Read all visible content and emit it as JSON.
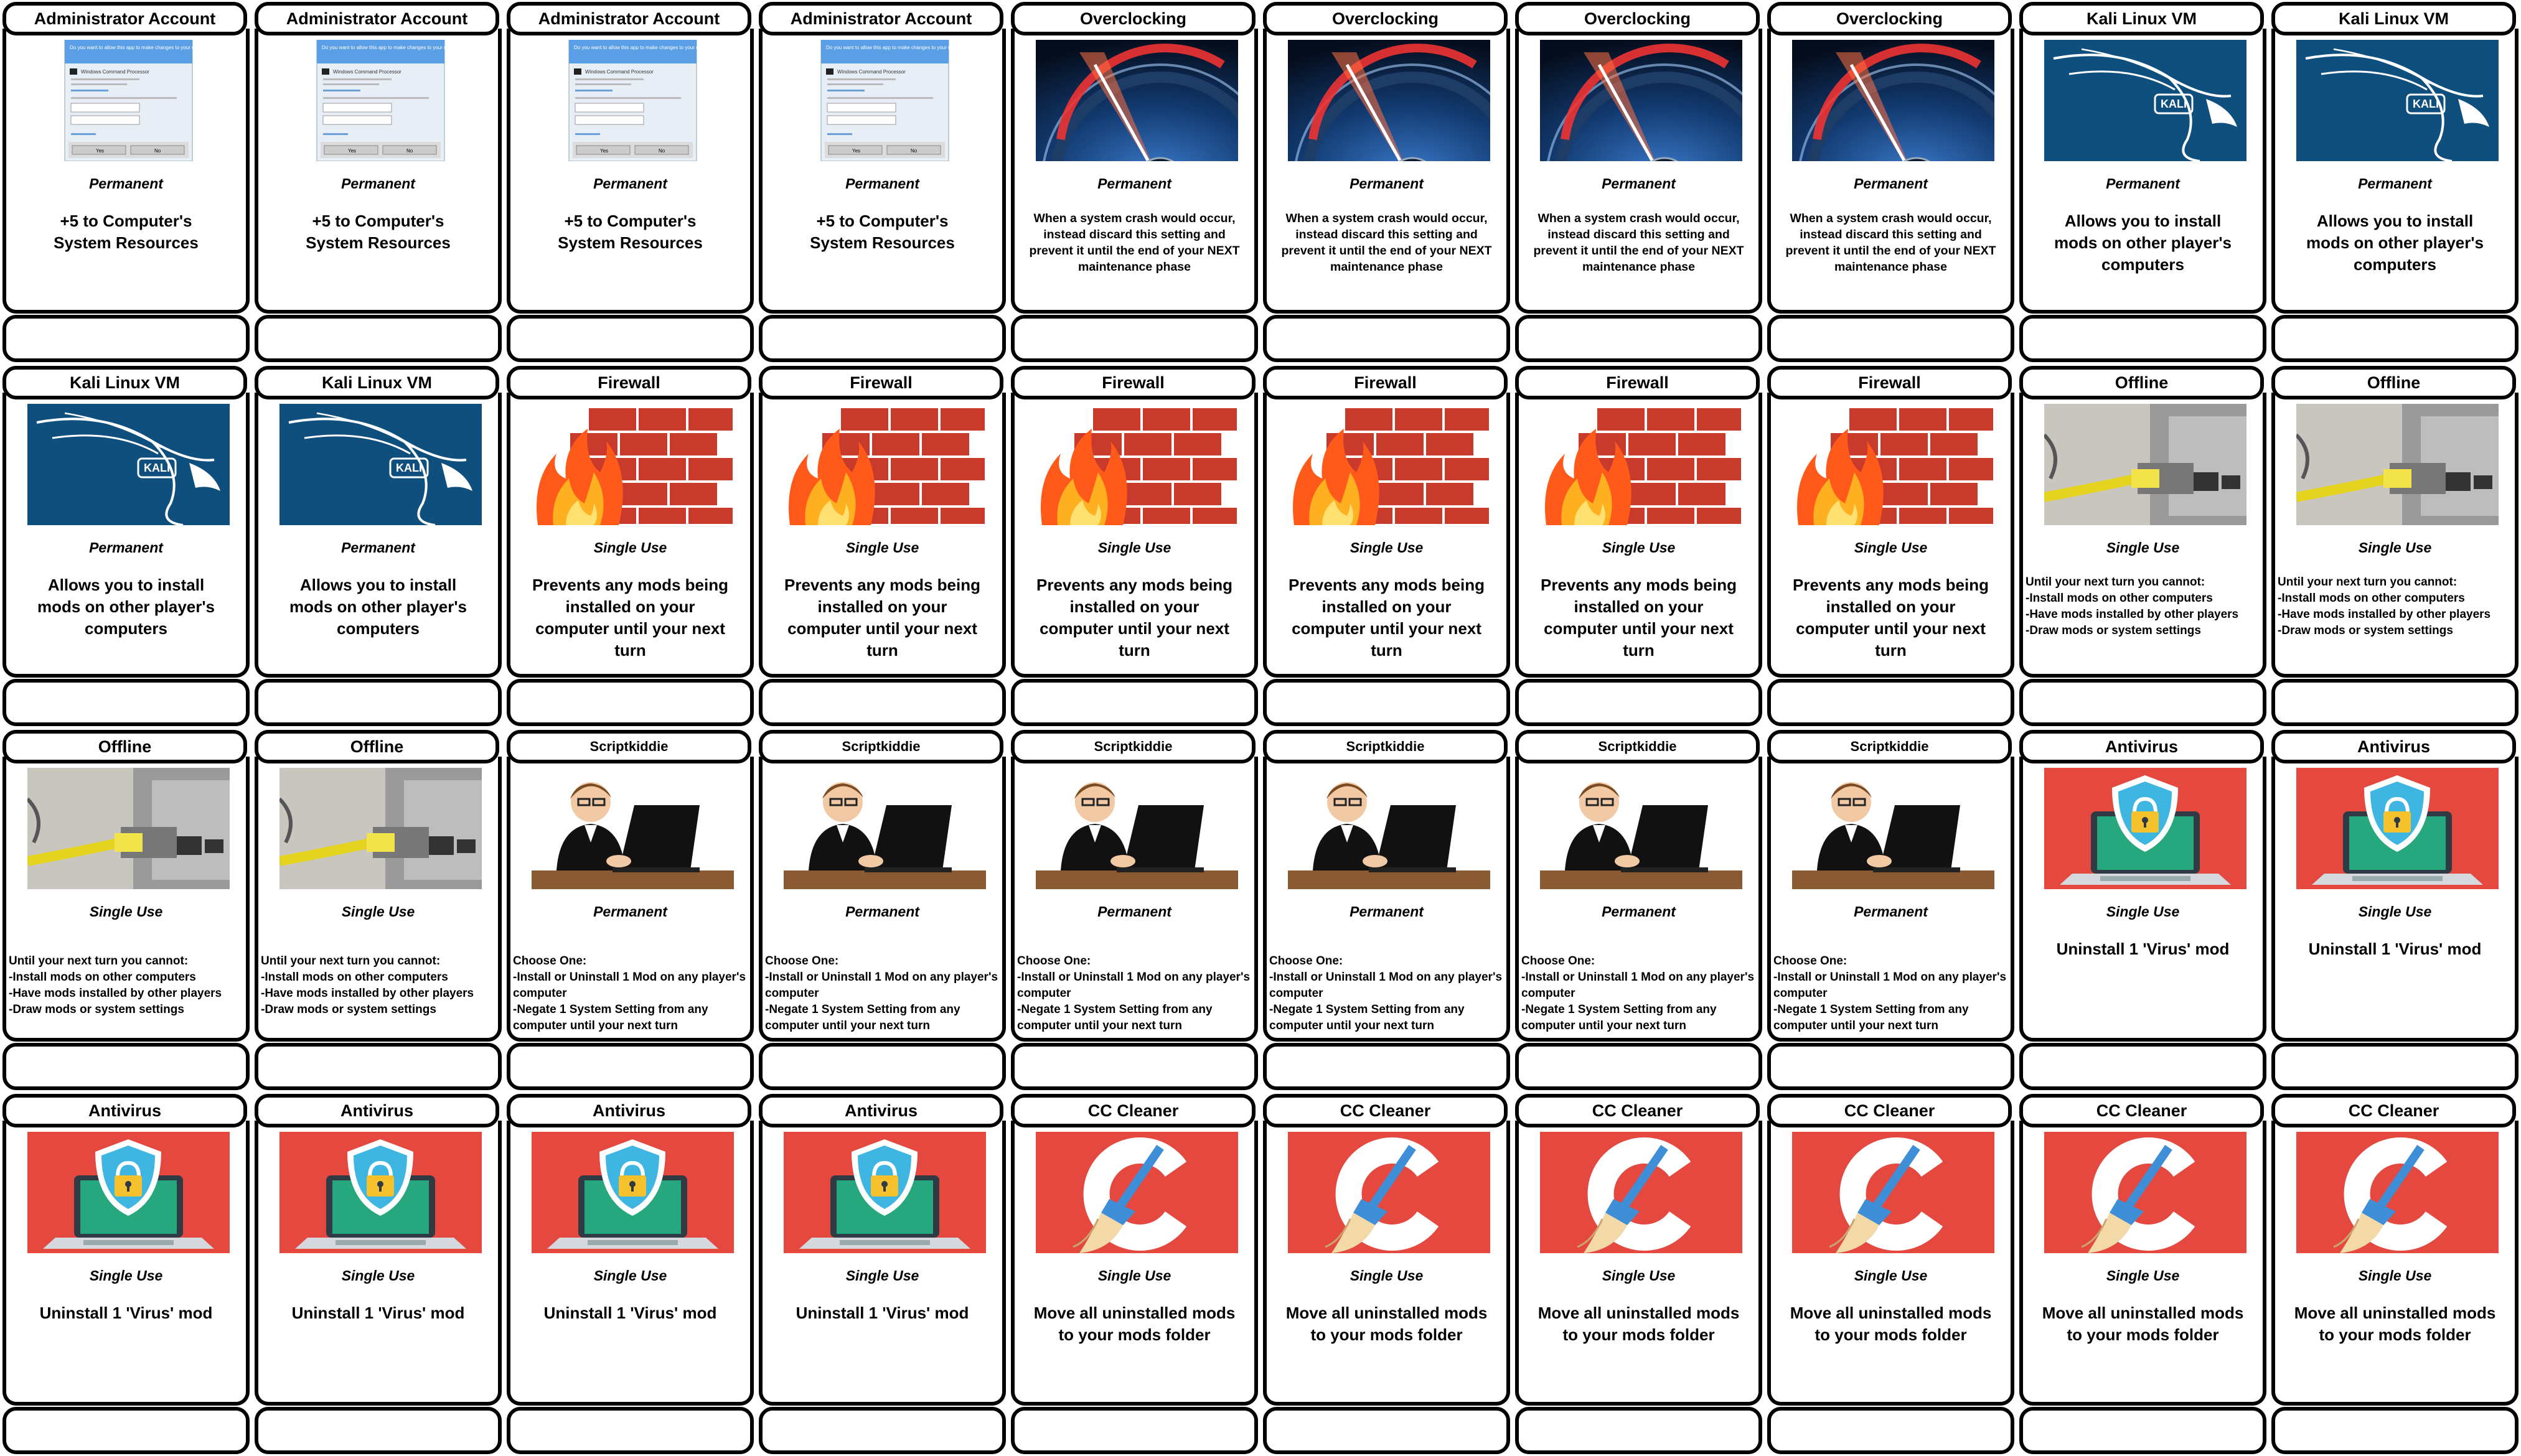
{
  "cards": [
    {
      "art": "uac-dialog",
      "title": "Administrator Account",
      "type": "Permanent",
      "desc": "+5 to Computer's\nSystem Resources",
      "style": "center"
    },
    {
      "art": "uac-dialog",
      "title": "Administrator Account",
      "type": "Permanent",
      "desc": "+5 to Computer's\nSystem Resources",
      "style": "center"
    },
    {
      "art": "uac-dialog",
      "title": "Administrator Account",
      "type": "Permanent",
      "desc": "+5 to Computer's\nSystem Resources",
      "style": "center"
    },
    {
      "art": "uac-dialog",
      "title": "Administrator Account",
      "type": "Permanent",
      "desc": "+5 to Computer's\nSystem Resources",
      "style": "center"
    },
    {
      "art": "speedometer",
      "title": "Overclocking",
      "type": "Permanent",
      "desc": "When a system crash would occur, instead discard this setting and prevent it until the end of your NEXT maintenance phase",
      "style": "small"
    },
    {
      "art": "speedometer",
      "title": "Overclocking",
      "type": "Permanent",
      "desc": "When a system crash would occur, instead discard this setting and prevent it until the end of your NEXT maintenance phase",
      "style": "small"
    },
    {
      "art": "speedometer",
      "title": "Overclocking",
      "type": "Permanent",
      "desc": "When a system crash would occur, instead discard this setting and prevent it until the end of your NEXT maintenance phase",
      "style": "small"
    },
    {
      "art": "speedometer",
      "title": "Overclocking",
      "type": "Permanent",
      "desc": "When a system crash would occur, instead discard this setting and prevent it until the end of your NEXT maintenance phase",
      "style": "small"
    },
    {
      "art": "kali-dragon",
      "title": "Kali Linux VM",
      "type": "Permanent",
      "desc": "Allows you to install mods on other player's computers",
      "style": "center"
    },
    {
      "art": "kali-dragon",
      "title": "Kali Linux VM",
      "type": "Permanent",
      "desc": "Allows you to install mods on other player's computers",
      "style": "center"
    },
    {
      "art": "kali-dragon",
      "title": "Kali Linux VM",
      "type": "Permanent",
      "desc": "Allows you to install mods on other player's computers",
      "style": "center"
    },
    {
      "art": "kali-dragon",
      "title": "Kali Linux VM",
      "type": "Permanent",
      "desc": "Allows you to install mods on other player's computers",
      "style": "center"
    },
    {
      "art": "firewall",
      "title": "Firewall",
      "type": "Single Use",
      "desc": "Prevents any mods being installed on your computer until your next turn",
      "style": "center"
    },
    {
      "art": "firewall",
      "title": "Firewall",
      "type": "Single Use",
      "desc": "Prevents any mods being installed on your computer until your next turn",
      "style": "center"
    },
    {
      "art": "firewall",
      "title": "Firewall",
      "type": "Single Use",
      "desc": "Prevents any mods being installed on your computer until your next turn",
      "style": "center"
    },
    {
      "art": "firewall",
      "title": "Firewall",
      "type": "Single Use",
      "desc": "Prevents any mods being installed on your computer until your next turn",
      "style": "center"
    },
    {
      "art": "firewall",
      "title": "Firewall",
      "type": "Single Use",
      "desc": "Prevents any mods being installed on your computer until your next turn",
      "style": "center"
    },
    {
      "art": "firewall",
      "title": "Firewall",
      "type": "Single Use",
      "desc": "Prevents any mods being installed on your computer until your next turn",
      "style": "center"
    },
    {
      "art": "ethernet-cable",
      "title": "Offline",
      "type": "Single Use",
      "desc": "Until your next turn you cannot:\n-Install mods on other computers\n-Have mods installed by other players\n-Draw mods or system settings",
      "style": "left"
    },
    {
      "art": "ethernet-cable",
      "title": "Offline",
      "type": "Single Use",
      "desc": "Until your next turn you cannot:\n-Install mods on other computers\n-Have mods installed by other players\n-Draw mods or system settings",
      "style": "left"
    },
    {
      "art": "ethernet-cable",
      "title": "Offline",
      "type": "Single Use",
      "desc": "Until your next turn you cannot:\n-Install mods on other computers\n-Have mods installed by other players\n-Draw mods or system settings",
      "style": "left-lower"
    },
    {
      "art": "ethernet-cable",
      "title": "Offline",
      "type": "Single Use",
      "desc": "Until your next turn you cannot:\n-Install mods on other computers\n-Have mods installed by other players\n-Draw mods or system settings",
      "style": "left-lower"
    },
    {
      "art": "kid-at-laptop",
      "title": "Scriptkiddie",
      "type": "Permanent",
      "desc": "Choose One:\n-Install or Uninstall 1 Mod on any player's computer\n-Negate 1 System Setting from any computer until your next turn",
      "style": "left-lower",
      "titleSmall": true
    },
    {
      "art": "kid-at-laptop",
      "title": "Scriptkiddie",
      "type": "Permanent",
      "desc": "Choose One:\n-Install or Uninstall 1 Mod on any player's computer\n-Negate 1 System Setting from any computer until your next turn",
      "style": "left-lower",
      "titleSmall": true
    },
    {
      "art": "kid-at-laptop",
      "title": "Scriptkiddie",
      "type": "Permanent",
      "desc": "Choose One:\n-Install or Uninstall 1 Mod on any player's computer\n-Negate 1 System Setting from any computer until your next turn",
      "style": "left-lower",
      "titleSmall": true
    },
    {
      "art": "kid-at-laptop",
      "title": "Scriptkiddie",
      "type": "Permanent",
      "desc": "Choose One:\n-Install or Uninstall 1 Mod on any player's computer\n-Negate 1 System Setting from any computer until your next turn",
      "style": "left-lower",
      "titleSmall": true
    },
    {
      "art": "kid-at-laptop",
      "title": "Scriptkiddie",
      "type": "Permanent",
      "desc": "Choose One:\n-Install or Uninstall 1 Mod on any player's computer\n-Negate 1 System Setting from any computer until your next turn",
      "style": "left-lower",
      "titleSmall": true
    },
    {
      "art": "kid-at-laptop",
      "title": "Scriptkiddie",
      "type": "Permanent",
      "desc": "Choose One:\n-Install or Uninstall 1 Mod on any player's computer\n-Negate 1 System Setting from any computer until your next turn",
      "style": "left-lower",
      "titleSmall": true
    },
    {
      "art": "antivirus-laptop",
      "title": "Antivirus",
      "type": "Single Use",
      "desc": "Uninstall 1 'Virus' mod",
      "style": "center"
    },
    {
      "art": "antivirus-laptop",
      "title": "Antivirus",
      "type": "Single Use",
      "desc": "Uninstall 1 'Virus' mod",
      "style": "center"
    },
    {
      "art": "antivirus-laptop",
      "title": "Antivirus",
      "type": "Single Use",
      "desc": "Uninstall 1 'Virus' mod",
      "style": "center"
    },
    {
      "art": "antivirus-laptop",
      "title": "Antivirus",
      "type": "Single Use",
      "desc": "Uninstall 1 'Virus' mod",
      "style": "center"
    },
    {
      "art": "antivirus-laptop",
      "title": "Antivirus",
      "type": "Single Use",
      "desc": "Uninstall 1 'Virus' mod",
      "style": "center"
    },
    {
      "art": "antivirus-laptop",
      "title": "Antivirus",
      "type": "Single Use",
      "desc": "Uninstall 1 'Virus' mod",
      "style": "center"
    },
    {
      "art": "ccleaner-logo",
      "title": "CC Cleaner",
      "type": "Single Use",
      "desc": "Move all uninstalled mods to your mods folder",
      "style": "center"
    },
    {
      "art": "ccleaner-logo",
      "title": "CC Cleaner",
      "type": "Single Use",
      "desc": "Move all uninstalled mods to your mods folder",
      "style": "center"
    },
    {
      "art": "ccleaner-logo",
      "title": "CC Cleaner",
      "type": "Single Use",
      "desc": "Move all uninstalled mods to your mods folder",
      "style": "center"
    },
    {
      "art": "ccleaner-logo",
      "title": "CC Cleaner",
      "type": "Single Use",
      "desc": "Move all uninstalled mods to your mods folder",
      "style": "center"
    },
    {
      "art": "ccleaner-logo",
      "title": "CC Cleaner",
      "type": "Single Use",
      "desc": "Move all uninstalled mods to your mods folder",
      "style": "center"
    },
    {
      "art": "ccleaner-logo",
      "title": "CC Cleaner",
      "type": "Single Use",
      "desc": "Move all uninstalled mods to your mods folder",
      "style": "center"
    }
  ],
  "art_text": {
    "uac_prompt": "Do you want to allow this app to make changes to your device?",
    "uac_app": "Windows Command Processor",
    "uac_yes": "Yes",
    "uac_no": "No",
    "kali_logo": "KALI"
  },
  "colors": {
    "kali_blue": "#0f4f7d",
    "firewall_brick": "#c83a2c",
    "antivirus_red": "#e4483e",
    "antivirus_green": "#27a77e",
    "ccleaner_red": "#e4483e",
    "uac_blue": "#5a9ee6"
  }
}
